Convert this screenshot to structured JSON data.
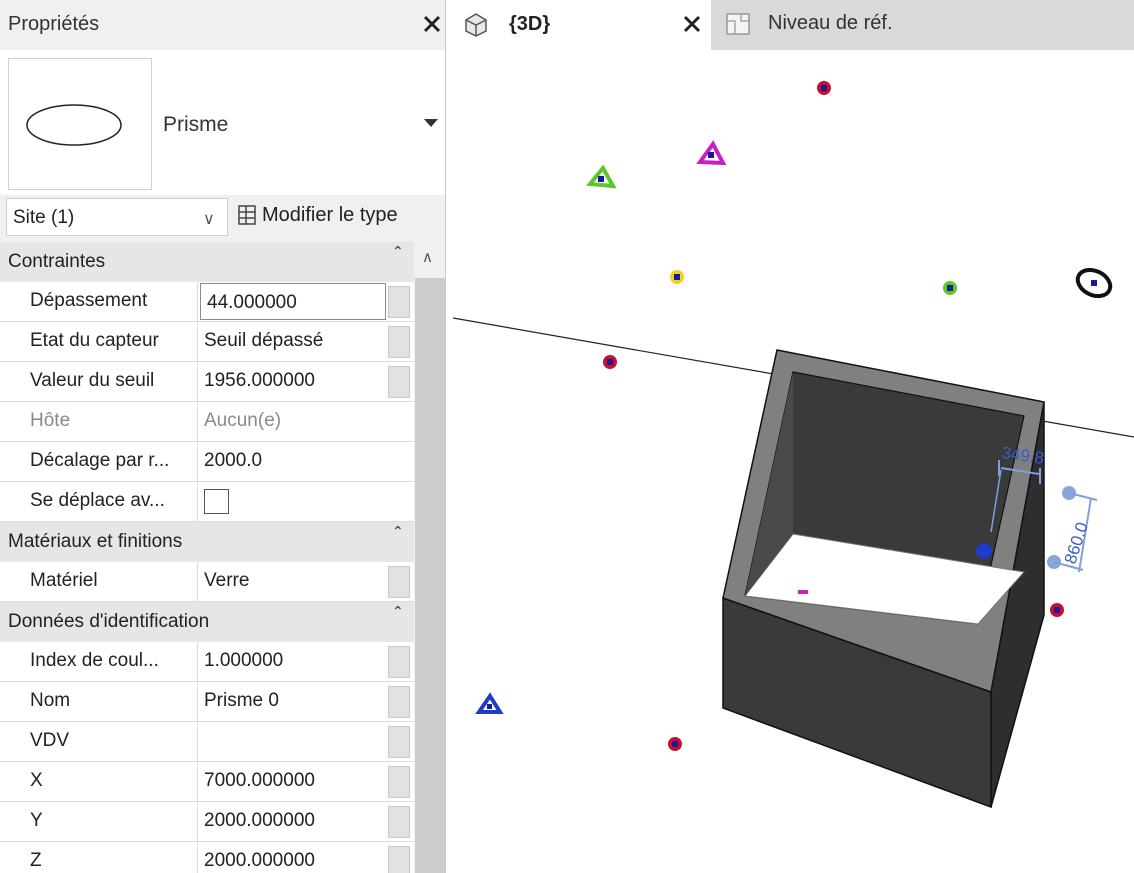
{
  "properties_panel": {
    "title": "Propriétés",
    "type_name": "Prisme",
    "instance_selector": "Site (1)",
    "edit_type_label": "Modifier le type",
    "groups": [
      {
        "label": "Contraintes",
        "rows": [
          {
            "name": "Dépassement",
            "value": "44.000000",
            "editing": true
          },
          {
            "name": "Etat du capteur",
            "value": "Seuil dépassé"
          },
          {
            "name": "Valeur du seuil",
            "value": "1956.000000"
          },
          {
            "name": "Hôte",
            "value": "Aucun(e)",
            "disabled": true
          },
          {
            "name": "Décalage par r...",
            "value": "2000.0"
          },
          {
            "name": "Se déplace av...",
            "value": "",
            "checkbox": true,
            "checked": false
          }
        ]
      },
      {
        "label": "Matériaux et finitions",
        "rows": [
          {
            "name": "Matériel",
            "value": "Verre"
          }
        ]
      },
      {
        "label": "Données d'identification",
        "rows": [
          {
            "name": "Index de coul...",
            "value": "1.000000"
          },
          {
            "name": "Nom",
            "value": "Prisme 0"
          },
          {
            "name": "VDV",
            "value": ""
          },
          {
            "name": "X",
            "value": "7000.000000"
          },
          {
            "name": "Y",
            "value": "2000.000000"
          },
          {
            "name": "Z",
            "value": "2000.000000"
          }
        ]
      }
    ]
  },
  "tabs": [
    {
      "label": "{3D}",
      "active": true,
      "icon": "house-3d-icon"
    },
    {
      "label": "Niveau de réf.",
      "active": false,
      "icon": "plan-view-icon"
    }
  ],
  "viewport": {
    "dimension_width": "349.8",
    "dimension_height": "860.0",
    "colors": {
      "red_marker": "#c8102e",
      "marker_center": "#1a1aa0",
      "green": "#5bc82a",
      "magenta": "#c81ec8",
      "yellow": "#f0d21e",
      "blue": "#1e3cc8",
      "box_dark": "#3a3a3a",
      "box_mid": "#7a7a7a",
      "dimension": "#7f9fe0"
    }
  }
}
